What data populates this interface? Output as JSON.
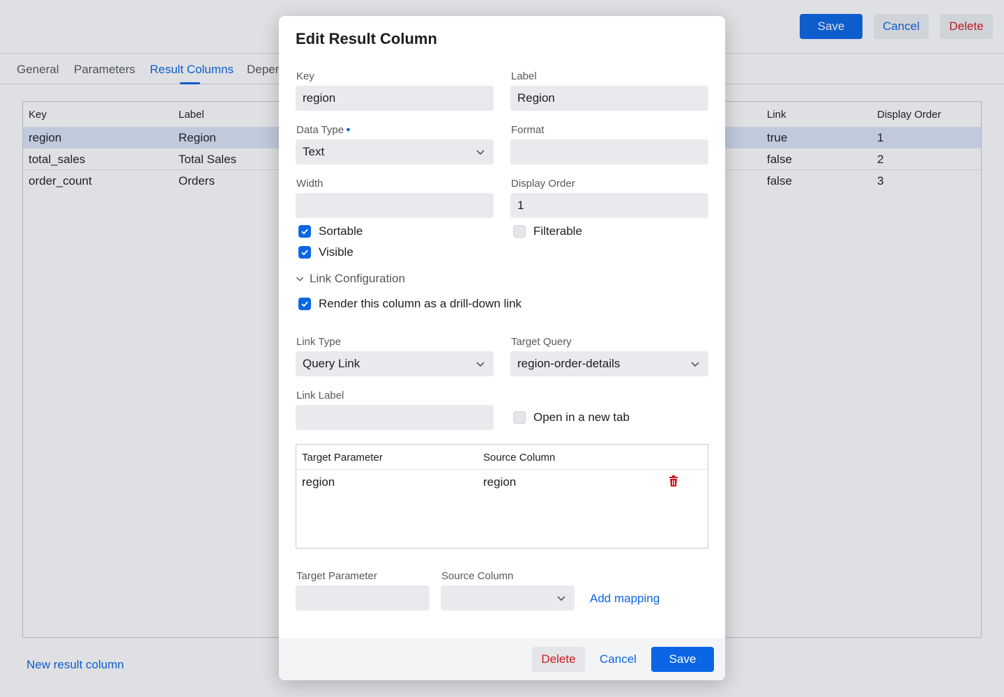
{
  "toolbar": {
    "save_label": "Save",
    "cancel_label": "Cancel",
    "delete_label": "Delete"
  },
  "tabs": [
    {
      "label": "General",
      "active": false
    },
    {
      "label": "Parameters",
      "active": false
    },
    {
      "label": "Result Columns",
      "active": true
    },
    {
      "label": "Depen",
      "active": false
    }
  ],
  "grid": {
    "columns": [
      "Key",
      "Label",
      "Link",
      "Display Order"
    ],
    "rows": [
      {
        "key": "region",
        "label": "Region",
        "link": "true",
        "order": "1",
        "selected": true
      },
      {
        "key": "total_sales",
        "label": "Total Sales",
        "link": "false",
        "order": "2",
        "selected": false
      },
      {
        "key": "order_count",
        "label": "Orders",
        "link": "false",
        "order": "3",
        "selected": false
      }
    ]
  },
  "new_result_column_label": "New result column",
  "modal": {
    "title": "Edit Result Column",
    "key": {
      "label": "Key",
      "value": "region"
    },
    "label": {
      "label": "Label",
      "value": "Region"
    },
    "data_type": {
      "label": "Data Type",
      "value": "Text"
    },
    "format": {
      "label": "Format",
      "value": ""
    },
    "width": {
      "label": "Width",
      "value": ""
    },
    "display_order": {
      "label": "Display Order",
      "value": "1"
    },
    "sortable": {
      "label": "Sortable",
      "checked": true
    },
    "filterable": {
      "label": "Filterable",
      "checked": false
    },
    "visible": {
      "label": "Visible",
      "checked": true
    },
    "link_section": {
      "title": "Link Configuration",
      "render_as_link": {
        "label": "Render this column as a drill-down link",
        "checked": true
      },
      "link_type": {
        "label": "Link Type",
        "value": "Query Link"
      },
      "target_query": {
        "label": "Target Query",
        "value": "region-order-details"
      },
      "link_label": {
        "label": "Link Label",
        "value": ""
      },
      "open_new_tab": {
        "label": "Open in a new tab",
        "checked": false
      },
      "mapping_table": {
        "headers": [
          "Target Parameter",
          "Source Column"
        ],
        "rows": [
          {
            "target": "region",
            "source": "region"
          }
        ]
      },
      "new_mapping": {
        "target_label": "Target Parameter",
        "target_value": "",
        "source_label": "Source Column",
        "source_value": "",
        "add_label": "Add mapping"
      }
    },
    "footer": {
      "delete_label": "Delete",
      "cancel_label": "Cancel",
      "save_label": "Save"
    }
  },
  "colors": {
    "accent": "#0a66e4",
    "danger": "#d11a1a",
    "selected_row": "#dbe6f6"
  }
}
